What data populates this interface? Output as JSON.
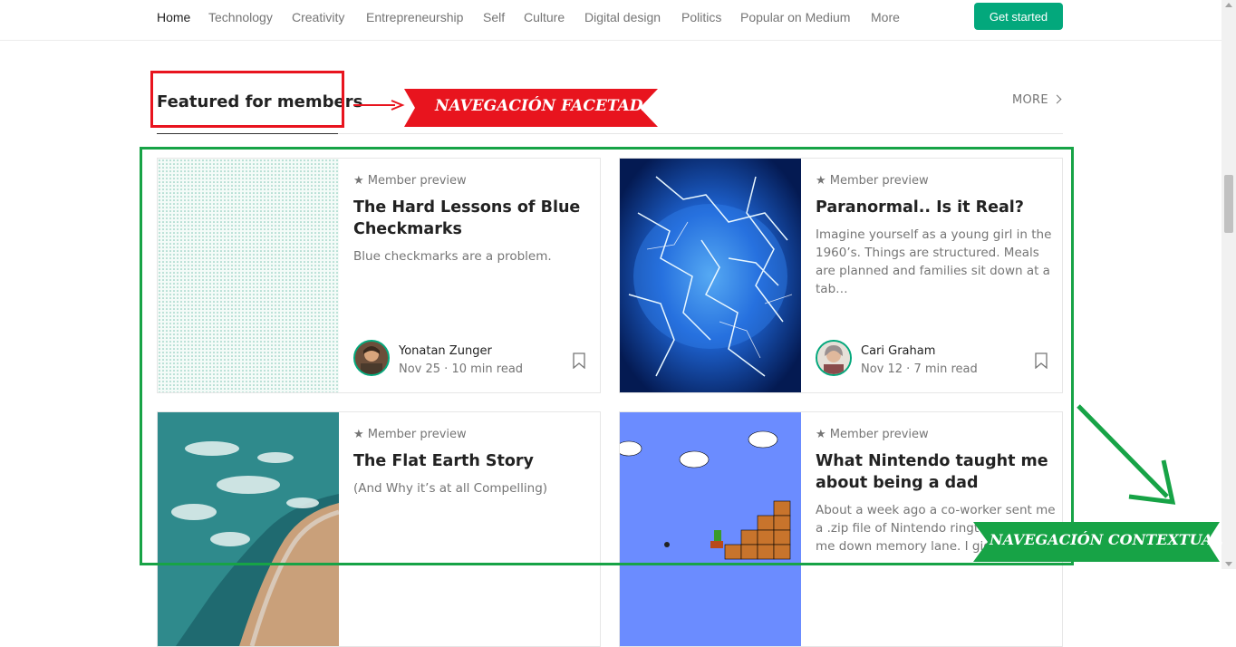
{
  "nav": {
    "items": [
      "Home",
      "Technology",
      "Creativity",
      "Entrepreneurship",
      "Self",
      "Culture",
      "Digital design",
      "Politics",
      "Popular on Medium",
      "More"
    ],
    "cta_label": "Get started",
    "accent": "#03a87c"
  },
  "section": {
    "title": "Featured for members",
    "more_label": "MORE"
  },
  "cards": [
    {
      "badge": "★ Member preview",
      "title": "The Hard Lessons of Blue Checkmarks",
      "excerpt": "Blue checkmarks are a problem.",
      "author": "Yonatan Zunger",
      "meta": "Nov 25 · 10 min read",
      "image": "dotted-pattern"
    },
    {
      "badge": "★ Member preview",
      "title": "Paranormal.. Is it Real?",
      "excerpt": "Imagine yourself as a young girl in the 1960’s. Things are structured. Meals are planned and families sit down at a tab…",
      "author": "Cari Graham",
      "meta": "Nov 12 · 7 min read",
      "image": "electric-brain"
    },
    {
      "badge": "★ Member preview",
      "title": "The Flat Earth Story",
      "excerpt": "(And Why it’s at all Compelling)",
      "image": "aerial-coast"
    },
    {
      "badge": "★ Member preview",
      "title": "What Nintendo taught me about being a dad",
      "excerpt": "About a week ago a co-worker sent me a .zip file of Nintendo ringtones, taking me down memory lane. I gigg…",
      "image": "mario-level"
    }
  ],
  "annotations": {
    "faceted": "NAVEGACIÓN FACETADA",
    "contextual": "NAVEGACIÓN CONTEXTUAL",
    "red": "#e8141e",
    "green": "#17a346"
  }
}
